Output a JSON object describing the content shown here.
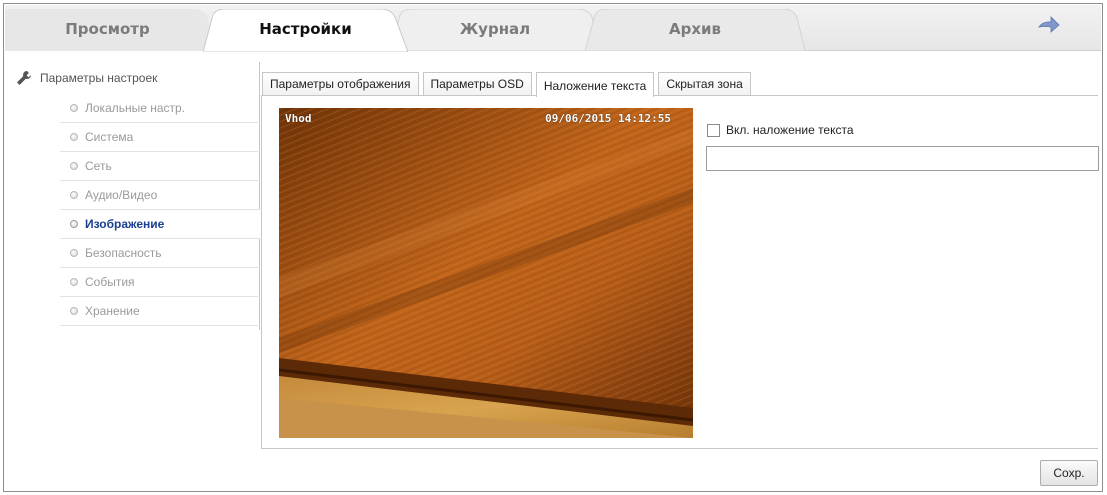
{
  "top_tabs": [
    {
      "label": "Просмотр"
    },
    {
      "label": "Настройки"
    },
    {
      "label": "Журнал"
    },
    {
      "label": "Архив"
    }
  ],
  "active_top_tab": "Настройки",
  "sidebar": {
    "header": "Параметры настроек",
    "items": [
      {
        "label": "Локальные настр."
      },
      {
        "label": "Система"
      },
      {
        "label": "Сеть"
      },
      {
        "label": "Аудио/Видео"
      },
      {
        "label": "Изображение"
      },
      {
        "label": "Безопасность"
      },
      {
        "label": "События"
      },
      {
        "label": "Хранение"
      }
    ],
    "active_item": "Изображение"
  },
  "sub_tabs": [
    {
      "label": "Параметры отображения"
    },
    {
      "label": "Параметры OSD"
    },
    {
      "label": "Наложение текста"
    },
    {
      "label": "Скрытая зона"
    }
  ],
  "active_sub_tab": "Наложение текста",
  "video": {
    "channel_name": "Vhod",
    "timestamp": "09/06/2015 14:12:55"
  },
  "overlay": {
    "enable_label": "Вкл. наложение текста",
    "enabled": false,
    "text_value": ""
  },
  "save_label": "Сохр.",
  "colors": {
    "active_sidebar_text": "#1b3f8f",
    "wood_light": "#c0641a",
    "wood_dark": "#6e3307"
  }
}
